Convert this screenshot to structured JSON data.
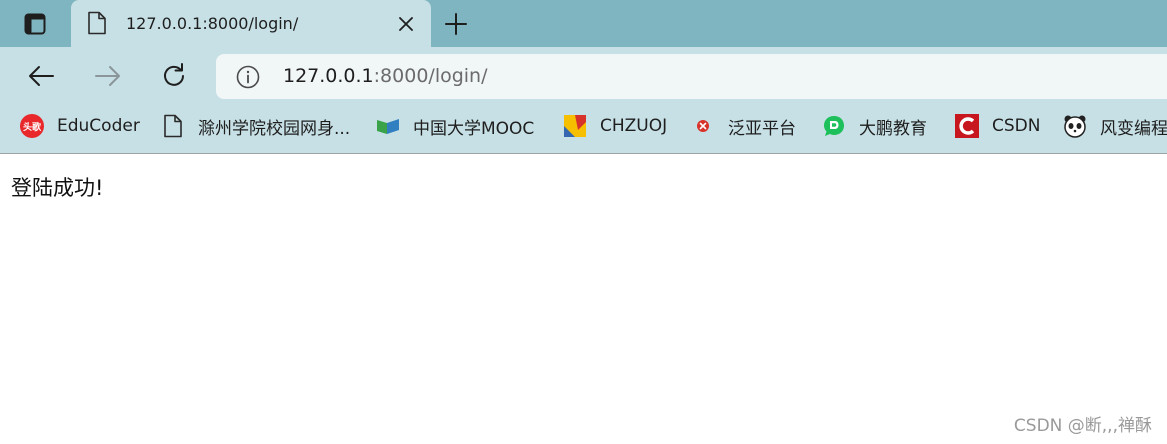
{
  "tab": {
    "title": "127.0.0.1:8000/login/",
    "close_icon": "close-icon",
    "favicon_icon": "document-icon"
  },
  "toolbar": {
    "back_icon": "arrow-left-icon",
    "forward_icon": "arrow-right-icon",
    "reload_icon": "reload-icon",
    "url_host": "127.0.0.1",
    "url_rest": ":8000/login/"
  },
  "bookmarks": [
    {
      "label": "EduCoder",
      "icon": "toutiao-icon"
    },
    {
      "label": "滁州学院校园网身...",
      "icon": "document-icon"
    },
    {
      "label": "中国大学MOOC",
      "icon": "mooc-icon"
    },
    {
      "label": "CHZUOJ",
      "icon": "chzuoj-icon"
    },
    {
      "label": "泛亚平台",
      "icon": "fanya-icon"
    },
    {
      "label": "大鹏教育",
      "icon": "chat-bubble-icon"
    },
    {
      "label": "CSDN",
      "icon": "csdn-icon"
    },
    {
      "label": "风变编程",
      "icon": "panda-icon"
    }
  ],
  "content": {
    "message": "登陆成功!",
    "watermark": "CSDN @断,,,禅酥"
  },
  "colors": {
    "tabstrip": "#7fb5c0",
    "toolbar": "#c7e0e5",
    "address_bg": "#f1f6f7",
    "watermark": "#9a9a9a"
  }
}
